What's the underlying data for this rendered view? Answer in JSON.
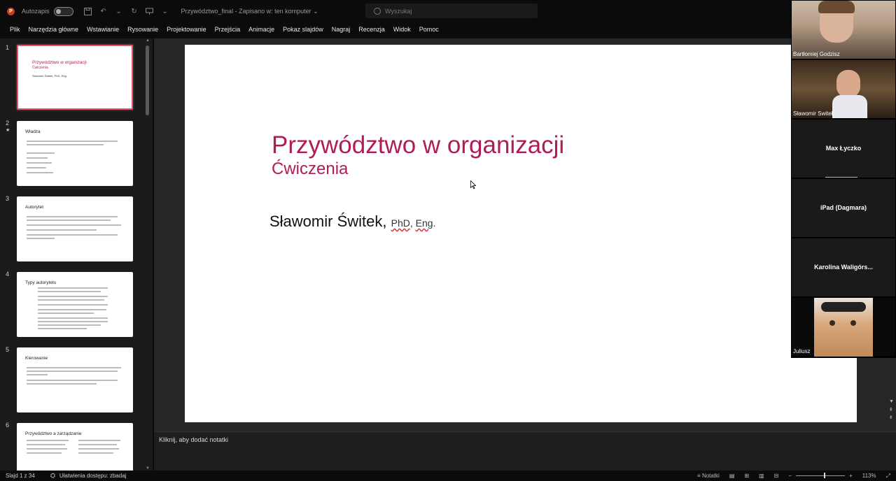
{
  "titlebar": {
    "autosave_label": "Autozapis",
    "doc_title": "Przywództwo_final  -  Zapisano w: ten komputer  ⌄"
  },
  "search": {
    "placeholder": "Wyszukaj"
  },
  "menu": [
    "Plik",
    "Narzędzia główne",
    "Wstawianie",
    "Rysowanie",
    "Projektowanie",
    "Przejścia",
    "Animacje",
    "Pokaz slajdów",
    "Nagraj",
    "Recenzja",
    "Widok",
    "Pomoc"
  ],
  "thumbnails": [
    {
      "num": "1",
      "title": "Przywództwo w organizacji",
      "sub": "Ćwiczenia",
      "author": "Sławomir Świtek, PhD, Eng."
    },
    {
      "num": "2",
      "title": "Władza",
      "star": true
    },
    {
      "num": "3",
      "title": "Autorytet"
    },
    {
      "num": "4",
      "title": "Typy autorytetu"
    },
    {
      "num": "5",
      "title": "Kierowanie"
    },
    {
      "num": "6",
      "title": "Przywództwo a zarządzanie"
    }
  ],
  "slide": {
    "title": "Przywództwo w organizacji",
    "subtitle": "Ćwiczenia",
    "author": "Sławomir Świtek,",
    "degree_phd": "PhD",
    "degree_sep": ", ",
    "degree_eng": "Eng",
    "degree_end": "."
  },
  "notes": {
    "placeholder": "Kliknij, aby dodać notatki"
  },
  "status": {
    "slide_count": "Slajd 1 z 34",
    "accessibility": "Ułatwienia dostępu: zbadaj",
    "notes_label": "Notatki",
    "zoom": "113%"
  },
  "participants": [
    {
      "name": "Bartłomiej Godzisz",
      "video": true
    },
    {
      "name": "Sławomir Switek",
      "video": true
    },
    {
      "name": "Max Łyczko",
      "video": false
    },
    {
      "name": "iPad (Dagmara)",
      "video": false
    },
    {
      "name": "Karolina  Waligórs...",
      "video": false
    },
    {
      "name": "Juliusz",
      "video": true
    }
  ],
  "colors": {
    "accent": "#b01c58",
    "thumb_active_border": "#e0566b"
  }
}
